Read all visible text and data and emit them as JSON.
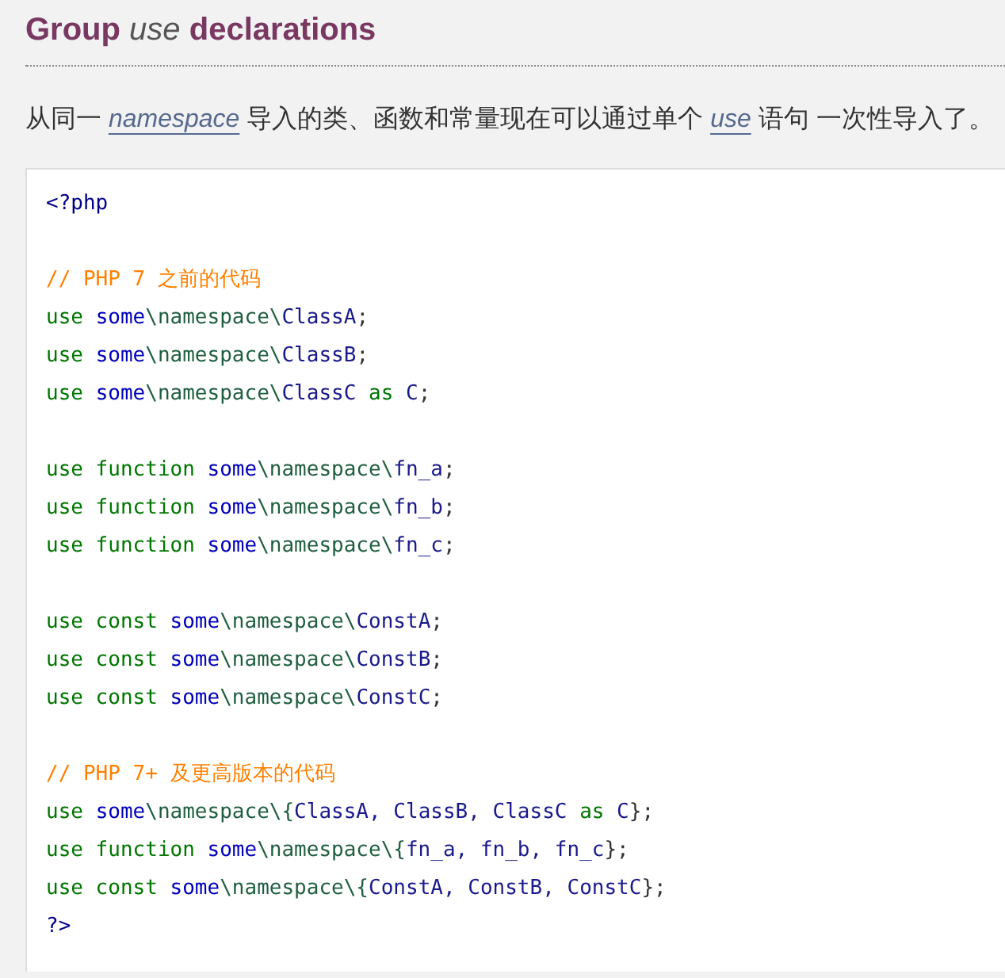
{
  "heading": "Group *use* declarations",
  "paragraph": [
    {
      "kind": "text",
      "text": "从同一 "
    },
    {
      "kind": "link",
      "text": "namespace"
    },
    {
      "kind": "text",
      "text": " 导入的类、函数和常量现在可以通过单个 "
    },
    {
      "kind": "link",
      "text": "use"
    },
    {
      "kind": "text",
      "text": " 语句 一次性导入了。"
    }
  ],
  "code": [
    {
      "kind": "code",
      "tokens": [
        {
          "kind": "tag",
          "t": "<?php"
        }
      ]
    },
    {
      "kind": "blank"
    },
    {
      "kind": "code",
      "tokens": [
        {
          "kind": "comment",
          "t": "// PHP 7 之前的代码"
        }
      ]
    },
    {
      "kind": "code",
      "tokens": [
        {
          "kind": "kw",
          "t": "use "
        },
        {
          "kind": "id",
          "t": "some"
        },
        {
          "kind": "path",
          "t": "\\namespace\\"
        },
        {
          "kind": "cls",
          "t": "ClassA"
        },
        {
          "kind": "punct",
          "t": ";"
        }
      ]
    },
    {
      "kind": "code",
      "tokens": [
        {
          "kind": "kw",
          "t": "use "
        },
        {
          "kind": "id",
          "t": "some"
        },
        {
          "kind": "path",
          "t": "\\namespace\\"
        },
        {
          "kind": "cls",
          "t": "ClassB"
        },
        {
          "kind": "punct",
          "t": ";"
        }
      ]
    },
    {
      "kind": "code",
      "tokens": [
        {
          "kind": "kw",
          "t": "use "
        },
        {
          "kind": "id",
          "t": "some"
        },
        {
          "kind": "path",
          "t": "\\namespace\\"
        },
        {
          "kind": "cls",
          "t": "ClassC "
        },
        {
          "kind": "kw",
          "t": "as "
        },
        {
          "kind": "cls",
          "t": "C"
        },
        {
          "kind": "punct",
          "t": ";"
        }
      ]
    },
    {
      "kind": "blank"
    },
    {
      "kind": "code",
      "tokens": [
        {
          "kind": "kw",
          "t": "use function "
        },
        {
          "kind": "id",
          "t": "some"
        },
        {
          "kind": "path",
          "t": "\\namespace\\"
        },
        {
          "kind": "cls",
          "t": "fn_a"
        },
        {
          "kind": "punct",
          "t": ";"
        }
      ]
    },
    {
      "kind": "code",
      "tokens": [
        {
          "kind": "kw",
          "t": "use function "
        },
        {
          "kind": "id",
          "t": "some"
        },
        {
          "kind": "path",
          "t": "\\namespace\\"
        },
        {
          "kind": "cls",
          "t": "fn_b"
        },
        {
          "kind": "punct",
          "t": ";"
        }
      ]
    },
    {
      "kind": "code",
      "tokens": [
        {
          "kind": "kw",
          "t": "use function "
        },
        {
          "kind": "id",
          "t": "some"
        },
        {
          "kind": "path",
          "t": "\\namespace\\"
        },
        {
          "kind": "cls",
          "t": "fn_c"
        },
        {
          "kind": "punct",
          "t": ";"
        }
      ]
    },
    {
      "kind": "blank"
    },
    {
      "kind": "code",
      "tokens": [
        {
          "kind": "kw",
          "t": "use const "
        },
        {
          "kind": "id",
          "t": "some"
        },
        {
          "kind": "path",
          "t": "\\namespace\\"
        },
        {
          "kind": "cls",
          "t": "ConstA"
        },
        {
          "kind": "punct",
          "t": ";"
        }
      ]
    },
    {
      "kind": "code",
      "tokens": [
        {
          "kind": "kw",
          "t": "use const "
        },
        {
          "kind": "id",
          "t": "some"
        },
        {
          "kind": "path",
          "t": "\\namespace\\"
        },
        {
          "kind": "cls",
          "t": "ConstB"
        },
        {
          "kind": "punct",
          "t": ";"
        }
      ]
    },
    {
      "kind": "code",
      "tokens": [
        {
          "kind": "kw",
          "t": "use const "
        },
        {
          "kind": "id",
          "t": "some"
        },
        {
          "kind": "path",
          "t": "\\namespace\\"
        },
        {
          "kind": "cls",
          "t": "ConstC"
        },
        {
          "kind": "punct",
          "t": ";"
        }
      ]
    },
    {
      "kind": "blank"
    },
    {
      "kind": "code",
      "tokens": [
        {
          "kind": "comment",
          "t": "// PHP 7+ 及更高版本的代码"
        }
      ]
    },
    {
      "kind": "code",
      "tokens": [
        {
          "kind": "kw",
          "t": "use "
        },
        {
          "kind": "id",
          "t": "some"
        },
        {
          "kind": "path",
          "t": "\\namespace\\{"
        },
        {
          "kind": "cls",
          "t": "ClassA, ClassB, ClassC "
        },
        {
          "kind": "kw",
          "t": "as "
        },
        {
          "kind": "cls",
          "t": "C"
        },
        {
          "kind": "punct",
          "t": "};"
        }
      ]
    },
    {
      "kind": "code",
      "tokens": [
        {
          "kind": "kw",
          "t": "use function "
        },
        {
          "kind": "id",
          "t": "some"
        },
        {
          "kind": "path",
          "t": "\\namespace\\{"
        },
        {
          "kind": "cls",
          "t": "fn_a, fn_b, fn_c"
        },
        {
          "kind": "punct",
          "t": "};"
        }
      ]
    },
    {
      "kind": "code",
      "tokens": [
        {
          "kind": "kw",
          "t": "use const "
        },
        {
          "kind": "id",
          "t": "some"
        },
        {
          "kind": "path",
          "t": "\\namespace\\{"
        },
        {
          "kind": "cls",
          "t": "ConstA, ConstB, ConstC"
        },
        {
          "kind": "punct",
          "t": "};"
        }
      ]
    },
    {
      "kind": "code",
      "tokens": [
        {
          "kind": "tag",
          "t": "?>"
        }
      ]
    }
  ]
}
